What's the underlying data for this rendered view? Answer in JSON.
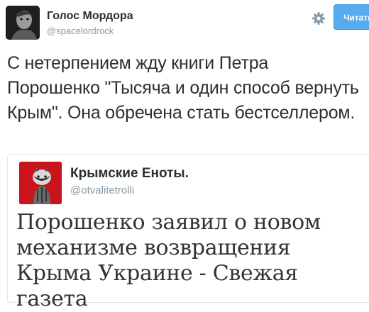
{
  "author": {
    "name": "Голос Мордора",
    "handle": "@spacelordrock"
  },
  "actions": {
    "follow_label": "Читать",
    "gear_icon": "gear-icon"
  },
  "tweet": {
    "text": "С нетерпением жду книги Петра Порошенко \"Тысяча и один способ вернуть Крым\". Она обречена стать бестселлером."
  },
  "quoted": {
    "name": "Крымские Еноты.",
    "handle": "@otvalitetrolli",
    "headline": "Порошенко заявил о новом механизме возвращения Крыма Украине - Свежая газета"
  },
  "colors": {
    "accent": "#55acee",
    "muted": "#8899a6",
    "quote_avatar_bg": "#c9141b"
  }
}
